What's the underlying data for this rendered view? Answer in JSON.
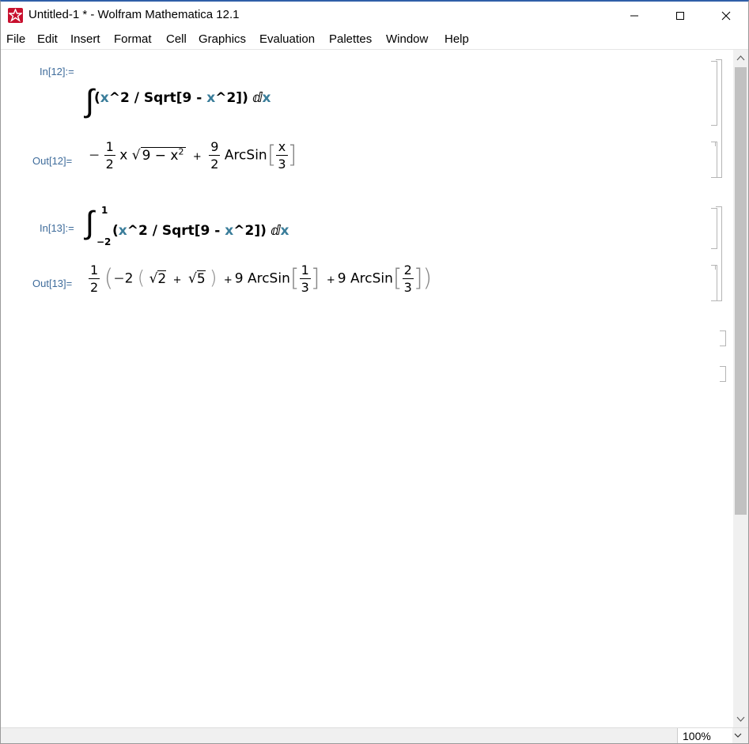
{
  "window": {
    "title": "Untitled-1 * - Wolfram Mathematica 12.1",
    "icon": "mathematica-spikey-icon"
  },
  "menu": [
    "File",
    "Edit",
    "Insert",
    "Format",
    "Cell",
    "Graphics",
    "Evaluation",
    "Palettes",
    "Window",
    "Help"
  ],
  "cells": {
    "in12": {
      "label": "In[12]:=",
      "integral": "∫",
      "open": "(",
      "var_x": "x",
      "pow": "^2 / Sqrt[9 - ",
      "var_x2": "x",
      "tail": "^2])",
      "d": "ⅆ",
      "var_x3": "x"
    },
    "out12": {
      "label": "Out[12]=",
      "minus": "−",
      "f1_num": "1",
      "f1_den": "2",
      "x": "x",
      "sqrt": "√",
      "radicand": "9 − x",
      "radicand_exp": "2",
      "plus": "+",
      "f2_num": "9",
      "f2_den": "2",
      "arcsin": "ArcSin",
      "lb": "[",
      "rb": "]",
      "f3_num": "x",
      "f3_den": "3"
    },
    "in13": {
      "label": "In[13]:=",
      "integral": "∫",
      "upper": "1",
      "lower": "−2",
      "open": "(",
      "var_x": "x",
      "pow": "^2 / Sqrt[9 - ",
      "var_x2": "x",
      "tail": "^2])",
      "d": "ⅆ",
      "var_x3": "x"
    },
    "out13": {
      "label": "Out[13]=",
      "f1_num": "1",
      "f1_den": "2",
      "lp": "(",
      "minus": "−",
      "two": "2",
      "lp2": "(",
      "sqrt": "√",
      "r1": "2",
      "plus": "+",
      "r2": "5",
      "rp2": ")",
      "plus2": "+",
      "nine": "9",
      "arcsin": "ArcSin",
      "lb": "[",
      "rb": "]",
      "a1_num": "1",
      "a1_den": "3",
      "plus3": "+",
      "nine2": "9",
      "arcsin2": "ArcSin",
      "a2_num": "2",
      "a2_den": "3",
      "rp": ")"
    }
  },
  "status": {
    "zoom": "100%"
  },
  "colors": {
    "label": "#3f6c9b",
    "variable": "#3a7d9a",
    "icon": "#c8102e"
  }
}
